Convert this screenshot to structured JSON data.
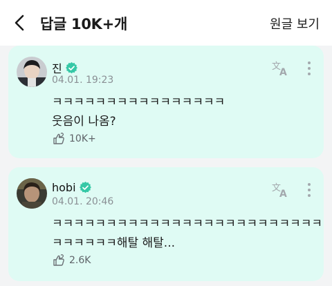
{
  "header": {
    "title": "답글 10K+개",
    "original_link": "원글 보기"
  },
  "comments": [
    {
      "author": "진",
      "timestamp": "04.01. 19:23",
      "lines": [
        "ㅋㅋㅋㅋㅋㅋㅋㅋㅋㅋㅋㅋㅋㅋㅋㅋ",
        "웃음이 나옴?"
      ],
      "likes": "10K+",
      "verified": true
    },
    {
      "author": "hobi",
      "timestamp": "04.01. 20:46",
      "lines": [
        "ㅋㅋㅋㅋㅋㅋㅋㅋㅋㅋㅋㅋㅋㅋㅋㅋㅋㅋㅋㅋㅋㅋㅋㅋㅋ",
        "ㅋㅋㅋㅋㅋㅋ해탈 해탈..."
      ],
      "likes": "2.6K",
      "verified": true
    }
  ],
  "colors": {
    "card_background": "#dffbf4",
    "verified_badge": "#35c8a6",
    "icon_gray": "#a3a8ad"
  },
  "icons": [
    "back-arrow-icon",
    "verified-icon",
    "translate-icon",
    "more-vertical-icon",
    "like-icon"
  ]
}
